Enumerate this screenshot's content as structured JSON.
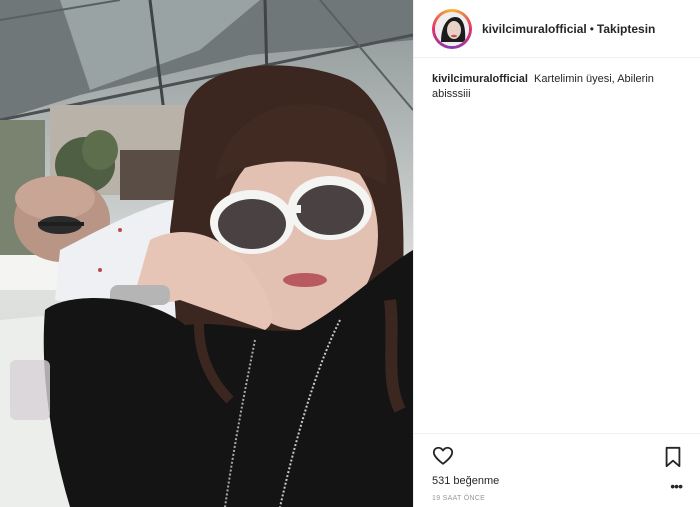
{
  "post": {
    "username": "kivilcimuralofficial",
    "separator": "•",
    "follow_status": "Takiptesin",
    "caption_user": "kivilcimuralofficial",
    "caption_text": "Kartelimin üyesi, Abilerin abisssiii",
    "likes": "531 beğenme",
    "time_ago": "19 SAAT ÖNCE",
    "more_symbol": "•••"
  },
  "icons": {
    "like": "heart-outline-icon",
    "save": "bookmark-icon",
    "options": "more-options-icon"
  },
  "colors": {
    "text": "#262626",
    "muted": "#999999",
    "border": "#efefef"
  }
}
